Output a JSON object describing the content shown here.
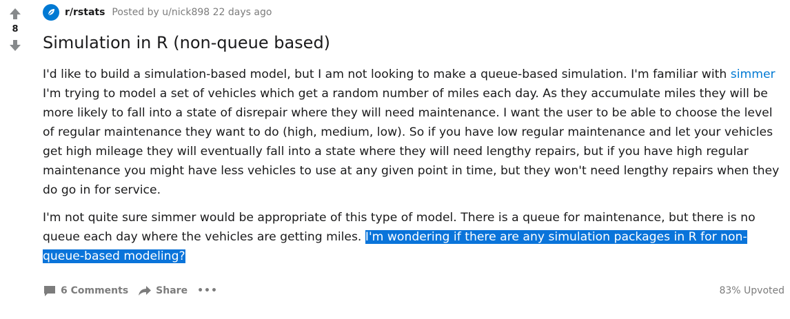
{
  "votes": {
    "count": "8"
  },
  "post": {
    "subreddit": "r/rstats",
    "posted_by": "Posted by u/nick898 22 days ago",
    "title": "Simulation in R (non-queue based)",
    "para1_before_link": "I'd like to build a simulation-based model, but I am not looking to make a queue-based simulation. I'm familiar with ",
    "para1_link": "simmer",
    "para1_after_link": " I'm trying to model a set of vehicles which get a random number of miles each day. As they accumulate miles they will be more likely to fall into a state of disrepair where they will need maintenance. I want the user to be able to choose the level of regular maintenance they want to do (high, medium, low). So if you have low regular maintenance and let your vehicles get high mileage they will eventually fall into a state where they will need lengthy repairs, but if you have high regular maintenance you might have less vehicles to use at any given point in time, but they won't need lengthy repairs when they do go in for service.",
    "para2_plain": "I'm not quite sure simmer would be appropriate of this type of model. There is a queue for maintenance, but there is no queue each day where the vehicles are getting miles. ",
    "para2_selected": "I'm wondering if there are any simulation packages in R for non-queue-based modeling?"
  },
  "actions": {
    "comments": "6 Comments",
    "share": "Share",
    "more": "•••",
    "upvoted": "83% Upvoted"
  },
  "colors": {
    "link": "#0079d3",
    "selection": "#0a74da",
    "muted": "#7c7c7c",
    "arrow": "#878a8c"
  }
}
